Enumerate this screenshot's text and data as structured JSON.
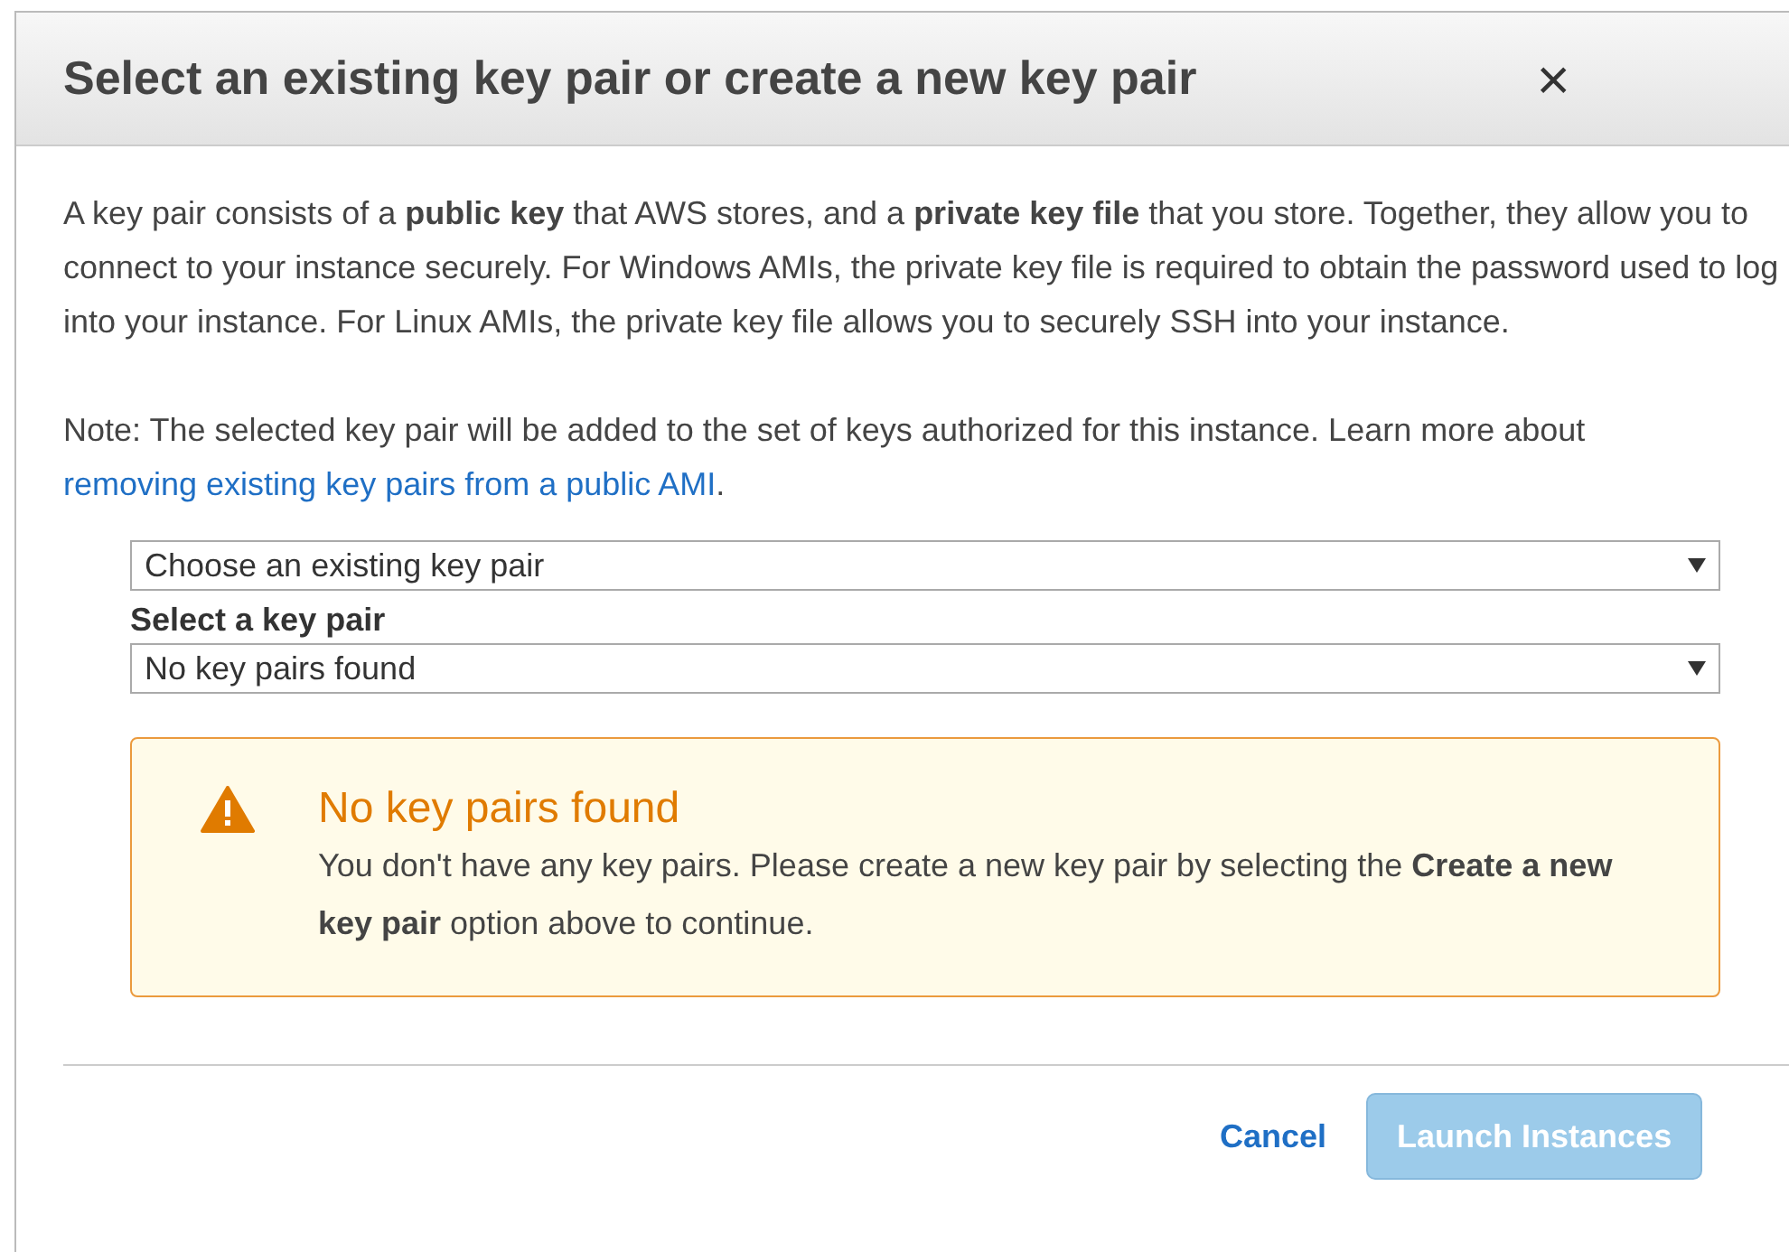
{
  "dialog": {
    "title": "Select an existing key pair or create a new key pair",
    "close": "×"
  },
  "intro": "A key pair consists of a **public key** that AWS stores, and a **private key file** that you store. Together, they allow you to connect to your instance securely. For Windows AMIs, the private key file is required to obtain the password used to log into your instance. For Linux AMIs, the private key file allows you to securely SSH into your instance.",
  "note": {
    "text": "Note: The selected key pair will be added to the set of keys authorized for this instance. Learn more about",
    "link": "removing existing key pairs from a public AMI",
    "end": "."
  },
  "mode_select": {
    "value": "Choose an existing key pair"
  },
  "key_select": {
    "label": "Select a key pair",
    "value": "No key pairs found"
  },
  "alert": {
    "title": "No key pairs found",
    "message": "You don't have any key pairs. Please create a new key pair by selecting the **Create a new key pair** option above to continue."
  },
  "buttons": [
    {
      "label": "Cancel",
      "kind": "link",
      "disabled": false
    },
    {
      "label": "Launch Instances",
      "kind": "primary",
      "disabled": true
    }
  ]
}
